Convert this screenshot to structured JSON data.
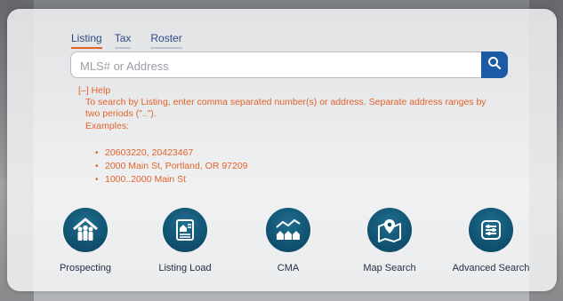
{
  "tabs": [
    {
      "label": "Listing",
      "active": true
    },
    {
      "label": "Tax",
      "active": false
    },
    {
      "label": "Roster",
      "active": false
    }
  ],
  "search": {
    "placeholder": "MLS# or Address",
    "value": "",
    "button_icon": "search-icon"
  },
  "help": {
    "toggle_label": "[–] Help",
    "text": "To search by Listing, enter comma separated number(s) or address. Separate address ranges by two periods (\"..\").",
    "examples_label": "Examples:",
    "examples": [
      "20603220, 20423467",
      "2000 Main St, Portland, OR 97209",
      "1000..2000 Main St"
    ]
  },
  "actions": [
    {
      "label": "Prospecting",
      "icon": "people-house-icon"
    },
    {
      "label": "Listing Load",
      "icon": "listing-document-icon"
    },
    {
      "label": "CMA",
      "icon": "houses-chart-icon"
    },
    {
      "label": "Map Search",
      "icon": "map-pin-icon"
    },
    {
      "label": "Advanced Search",
      "icon": "sliders-icon"
    }
  ],
  "colors": {
    "accent": "#e2632a",
    "primary": "#1c5aa6",
    "icon_bg": "#0f4e6c",
    "tab_text": "#2e4a86"
  }
}
